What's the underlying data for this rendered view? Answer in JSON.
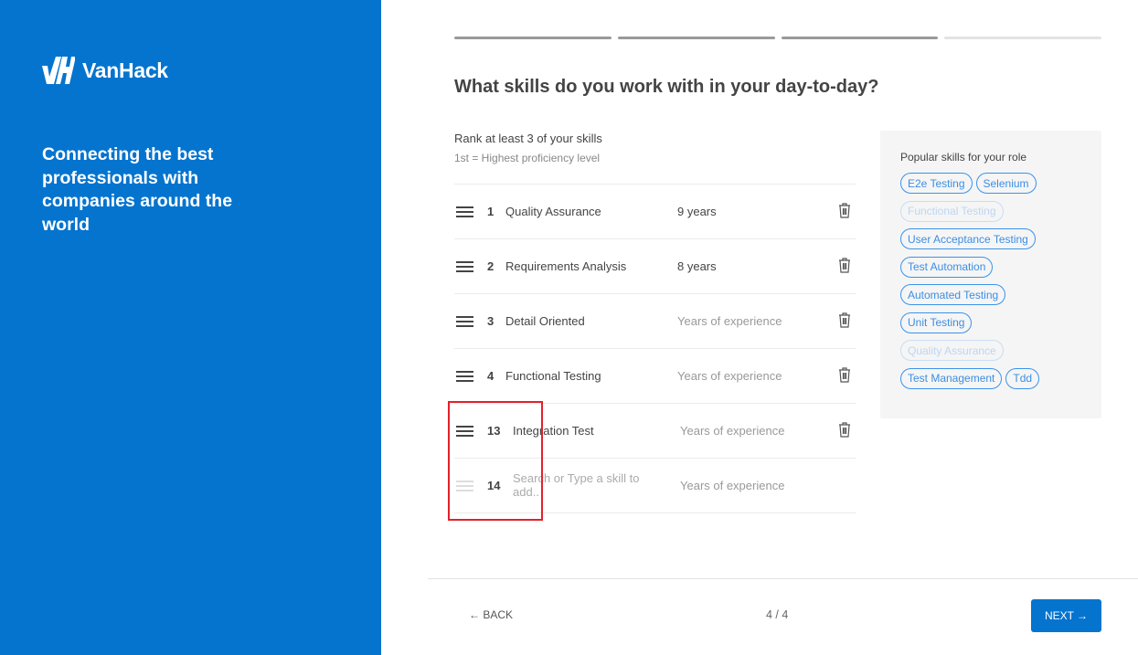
{
  "sidebar": {
    "brand": "VanHack",
    "tagline": "Connecting the best professionals with companies around the world",
    "brand_color": "#0474cf"
  },
  "progress": {
    "current_step": 4,
    "total_steps": 4,
    "completed_segments": 3
  },
  "main": {
    "title": "What skills do you work with in your day-to-day?",
    "instruction": "Rank at least 3 of your skills",
    "hint": "1st = Highest proficiency level",
    "skills": [
      {
        "rank": "1",
        "name": "Quality Assurance",
        "years": "9 years"
      },
      {
        "rank": "2",
        "name": "Requirements Analysis",
        "years": "8 years"
      },
      {
        "rank": "3",
        "name": "Detail Oriented",
        "years_placeholder": "Years of experience"
      },
      {
        "rank": "4",
        "name": "Functional Testing",
        "years_placeholder": "Years of experience"
      },
      {
        "rank": "13",
        "name": "Integration Test",
        "years_placeholder": "Years of experience"
      }
    ],
    "new_skill": {
      "rank": "14",
      "placeholder": "Search or Type a skill to add..",
      "years_placeholder": "Years of experience"
    }
  },
  "popular": {
    "title": "Popular skills for your role",
    "tags": [
      {
        "label": "E2e Testing",
        "disabled": false
      },
      {
        "label": "Selenium",
        "disabled": false
      },
      {
        "label": "Functional Testing",
        "disabled": true
      },
      {
        "label": "User Acceptance Testing",
        "disabled": false
      },
      {
        "label": "Test Automation",
        "disabled": false
      },
      {
        "label": "Automated Testing",
        "disabled": false
      },
      {
        "label": "Unit Testing",
        "disabled": false
      },
      {
        "label": "Quality Assurance",
        "disabled": true
      },
      {
        "label": "Test Management",
        "disabled": false
      },
      {
        "label": "Tdd",
        "disabled": false
      }
    ]
  },
  "footer": {
    "back_label": "← BACK",
    "pager": "4 / 4",
    "next_label": "NEXT →"
  }
}
